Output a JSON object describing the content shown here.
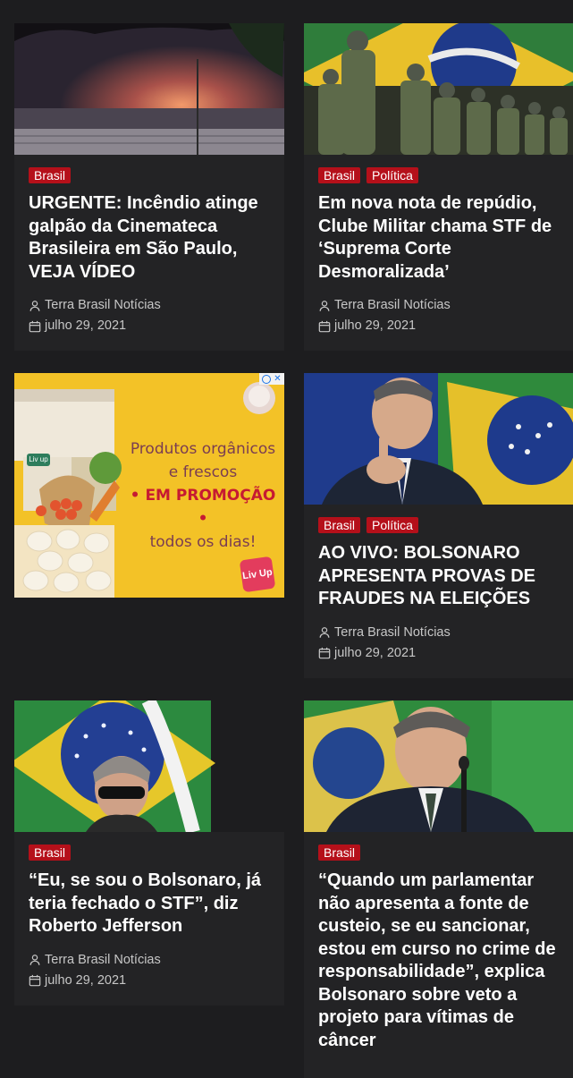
{
  "articles": [
    {
      "categories": [
        "Brasil"
      ],
      "title": "URGENTE: Incêndio atinge galpão da Cinemateca Brasileira em São Paulo, VEJA VÍDEO",
      "author": "Terra Brasil Notícias",
      "date": "julho 29, 2021"
    },
    {
      "categories": [
        "Brasil",
        "Política"
      ],
      "title": "Em nova nota de repúdio, Clube Militar chama STF de ‘Suprema Corte Desmoralizada’",
      "author": "Terra Brasil Notícias",
      "date": "julho 29, 2021"
    },
    {
      "categories": [
        "Brasil",
        "Política"
      ],
      "title": "AO VIVO: BOLSONARO APRESENTA PROVAS DE FRAUDES NA ELEIÇÕES",
      "author": "Terra Brasil Notícias",
      "date": "julho 29, 2021"
    },
    {
      "categories": [
        "Brasil"
      ],
      "title": "“Eu, se sou o Bolsonaro, já teria fechado o STF”, diz Roberto Jefferson",
      "author": "Terra Brasil Notícias",
      "date": "julho 29, 2021"
    },
    {
      "categories": [
        "Brasil"
      ],
      "title": "“Quando um parlamentar não apresenta a fonte de custeio, se eu sancionar, estou em curso no crime de responsabilidade”, explica Bolsonaro sobre veto a projeto para vítimas de câncer"
    }
  ],
  "ad": {
    "line1": "Produtos orgânicos",
    "line2": "e frescos",
    "promo": "• EM PROMOÇÃO •",
    "line3": "todos os dias!",
    "brand": "Liv Up",
    "box_label": "Liv up"
  },
  "colors": {
    "background": "#1d1d1f",
    "card": "#232325",
    "category_badge": "#b5101a",
    "ad_background": "#f3c227"
  },
  "icons": {
    "author": "user-icon",
    "date": "calendar-icon",
    "ad_close": "close-icon"
  }
}
